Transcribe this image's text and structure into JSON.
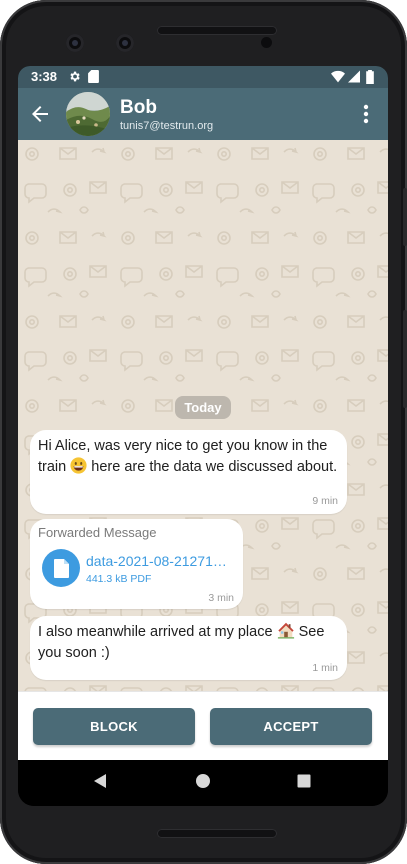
{
  "status_bar": {
    "time": "3:38",
    "left_icons": [
      "gear-icon",
      "sd-card-icon"
    ],
    "right_icons": [
      "wifi-icon",
      "signal-icon",
      "battery-icon"
    ]
  },
  "header": {
    "contact_name": "Bob",
    "contact_address": "tunis7@testrun.org",
    "back_icon": "arrow-back-icon",
    "menu_icon": "more-vert-icon"
  },
  "chat": {
    "date_divider": "Today",
    "messages": [
      {
        "text_before_emoji": "Hi Alice, was very nice to get you know in the train ",
        "emoji": "grinning-face",
        "text_after_emoji": " here are the data we discussed about.",
        "time": "9 min"
      },
      {
        "forwarded_label": "Forwarded Message",
        "file_name": "data-2021-08-21271…",
        "file_meta": "441.3 kB PDF",
        "file_icon": "document-icon",
        "time": "3 min"
      },
      {
        "text_before_emoji": "I also meanwhile arrived at my place ",
        "emoji": "house",
        "text_after_emoji": " See you soon :)",
        "time": "1 min"
      }
    ]
  },
  "actions": {
    "block_label": "BLOCK",
    "accept_label": "ACCEPT"
  },
  "nav": {
    "back": "nav-back-icon",
    "home": "nav-home-icon",
    "recents": "nav-recents-icon"
  },
  "colors": {
    "app_bar": "#4b6b77",
    "status_bar": "#3e5863",
    "chat_background": "#e9e1d5",
    "link": "#3d9be0",
    "button": "#4b6b77"
  }
}
